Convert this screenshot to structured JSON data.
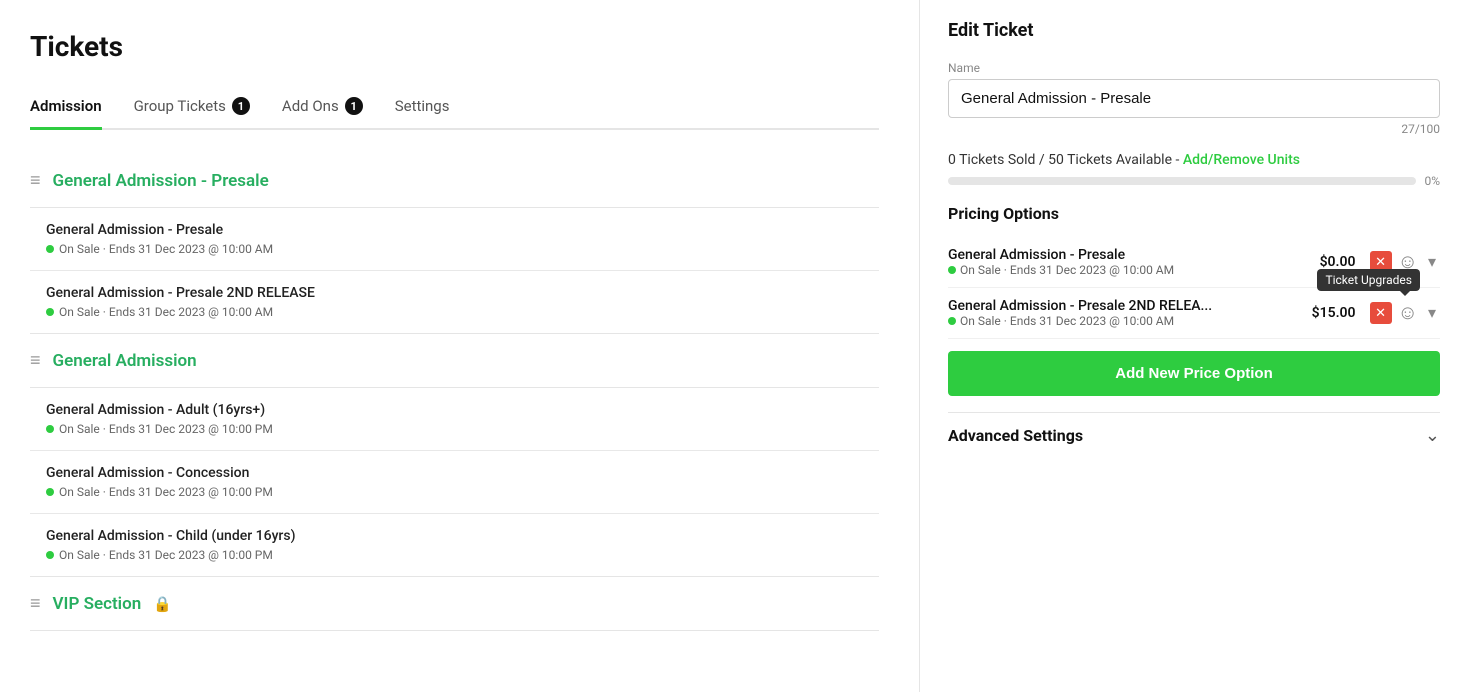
{
  "page": {
    "title": "Tickets"
  },
  "tabs": [
    {
      "id": "admission",
      "label": "Admission",
      "badge": null,
      "active": true
    },
    {
      "id": "group-tickets",
      "label": "Group Tickets",
      "badge": "1",
      "active": false
    },
    {
      "id": "add-ons",
      "label": "Add Ons",
      "badge": "1",
      "active": false
    },
    {
      "id": "settings",
      "label": "Settings",
      "badge": null,
      "active": false
    }
  ],
  "ticket_groups": [
    {
      "id": "presale",
      "name": "General Admission - Presale",
      "locked": false,
      "tickets": [
        {
          "name": "General Admission - Presale",
          "status": "On Sale · Ends 31 Dec 2023 @ 10:00 AM"
        },
        {
          "name": "General Admission - Presale 2ND RELEASE",
          "status": "On Sale · Ends 31 Dec 2023 @ 10:00 AM"
        }
      ]
    },
    {
      "id": "general",
      "name": "General Admission",
      "locked": false,
      "tickets": [
        {
          "name": "General Admission - Adult (16yrs+)",
          "status": "On Sale · Ends 31 Dec 2023 @ 10:00 PM"
        },
        {
          "name": "General Admission - Concession",
          "status": "On Sale · Ends 31 Dec 2023 @ 10:00 PM"
        },
        {
          "name": "General Admission - Child (under 16yrs)",
          "status": "On Sale · Ends 31 Dec 2023 @ 10:00 PM"
        }
      ]
    },
    {
      "id": "vip",
      "name": "VIP Section",
      "locked": true,
      "tickets": []
    }
  ],
  "edit_panel": {
    "title": "Edit Ticket",
    "name_label": "Name",
    "name_value": "General Admission - Presale",
    "char_count": "27/100",
    "tickets_sold_text": "0 Tickets Sold / 50 Tickets Available",
    "add_remove_link": "Add/Remove Units",
    "progress_pct": "0%",
    "pricing_options_title": "Pricing Options",
    "pricing_rows": [
      {
        "name": "General Admission - Presale",
        "status": "On Sale · Ends 31 Dec 2023 @ 10:00 AM",
        "price": "$0.00"
      },
      {
        "name": "General Admission - Presale 2ND RELEA...",
        "status": "On Sale · Ends 31 Dec 2023 @ 10:00 AM",
        "price": "$15.00"
      }
    ],
    "add_price_label": "Add New Price Option",
    "advanced_settings_label": "Advanced Settings",
    "tooltip_text": "Ticket Upgrades"
  }
}
